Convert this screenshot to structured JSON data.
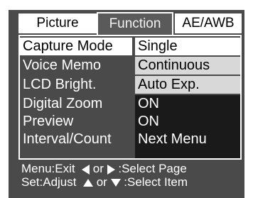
{
  "tabs": [
    {
      "label": "Picture"
    },
    {
      "label": "Function"
    },
    {
      "label": "AE/AWB"
    }
  ],
  "menu": {
    "items": [
      {
        "label": "Capture Mode",
        "value": "Single"
      },
      {
        "label": "Voice Memo",
        "value": "Continuous"
      },
      {
        "label": "LCD Bright.",
        "value": "Auto Exp."
      },
      {
        "label": "Digital Zoom",
        "value": "ON"
      },
      {
        "label": "Preview",
        "value": "ON"
      },
      {
        "label": "Interval/Count",
        "value": "Next Menu"
      }
    ]
  },
  "footer": {
    "line1_a": "Menu:Exit",
    "line1_or": "or",
    "line1_b": ":Select Page",
    "line2_a": "Set:Adjust",
    "line2_or": "or",
    "line2_b": ":Select Item"
  },
  "icons": [
    "left-arrow-icon",
    "right-arrow-icon",
    "up-arrow-icon",
    "down-arrow-icon"
  ]
}
